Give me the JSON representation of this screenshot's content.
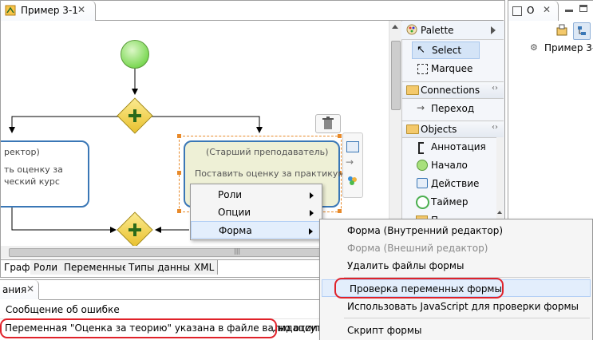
{
  "editor": {
    "tab_title": "Пример 3-1",
    "bottom_tabs": [
      "Граф",
      "Роли",
      "Переменные",
      "Типы данных",
      "XML"
    ],
    "left_task": {
      "role": "ректор)",
      "line1": "ть оценку за",
      "line2": "ческий курс"
    },
    "right_task": {
      "role": "(Старший преподаватель)",
      "name": "Поставить оценку за практикум"
    }
  },
  "palette": {
    "title": "Palette",
    "tools": [
      {
        "label": "Select",
        "icon": "arrow-icon"
      },
      {
        "label": "Marquee",
        "icon": "marquee-icon"
      }
    ],
    "groups": [
      {
        "label": "Connections",
        "items": [
          {
            "label": "Переход",
            "icon": "transition-icon"
          }
        ]
      },
      {
        "label": "Objects",
        "items": [
          {
            "label": "Аннотация",
            "icon": "annotation-icon"
          },
          {
            "label": "Начало",
            "icon": "start-icon"
          },
          {
            "label": "Действие",
            "icon": "action-icon"
          },
          {
            "label": "Таймер",
            "icon": "timer-icon"
          },
          {
            "label": "П",
            "icon": "folder-icon"
          }
        ]
      }
    ]
  },
  "outline": {
    "tab_title": "O",
    "tree_item": "Пример 3-"
  },
  "problems": {
    "tab_title": "ания",
    "column_header": "Сообщение об ошибке",
    "row": "Переменная \"Оценка за теорию\" указана в файле валидации",
    "row_tail": ", но отсутс"
  },
  "context_menu": {
    "items": [
      "Роли",
      "Опции",
      "Форма"
    ]
  },
  "submenu": {
    "items": [
      {
        "label": "Форма (Внутренний редактор)",
        "enabled": true
      },
      {
        "label": "Форма (Внешний редактор)",
        "enabled": false
      },
      {
        "label": "Удалить файлы формы",
        "enabled": true
      },
      {
        "label": "Проверка переменных формы",
        "enabled": true
      },
      {
        "label": "Использовать JavaScript для проверки формы",
        "enabled": true
      },
      {
        "label": "Скрипт формы",
        "enabled": true
      }
    ]
  },
  "colors": {
    "highlight": "#e0222a",
    "task_border": "#3a77b6",
    "gateway": "#f3d43a",
    "start": "#7ed957"
  }
}
